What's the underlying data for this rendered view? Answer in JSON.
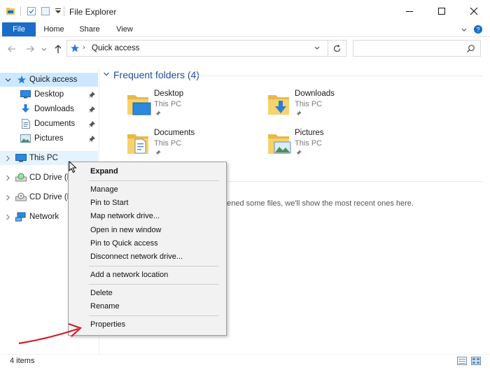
{
  "window": {
    "title": "File Explorer",
    "minimize_icon": "minimize-icon",
    "maximize_icon": "maximize-icon",
    "close_icon": "close-icon"
  },
  "ribbon": {
    "tabs": [
      {
        "label": "File"
      },
      {
        "label": "Home"
      },
      {
        "label": "Share"
      },
      {
        "label": "View"
      }
    ]
  },
  "address": {
    "path": "Quick access",
    "search_placeholder": ""
  },
  "nav": {
    "quick_access": "Quick access",
    "pinned": [
      {
        "label": "Desktop"
      },
      {
        "label": "Downloads"
      },
      {
        "label": "Documents"
      },
      {
        "label": "Pictures"
      }
    ],
    "this_pc": "This PC",
    "cd_drive_1": "CD Drive (D:",
    "cd_drive_2": "CD Drive (E:)",
    "network": "Network"
  },
  "content": {
    "frequent_header": "Frequent folders (4)",
    "folders": [
      {
        "name": "Desktop",
        "location": "This PC"
      },
      {
        "name": "Downloads",
        "location": "This PC"
      },
      {
        "name": "Documents",
        "location": "This PC"
      },
      {
        "name": "Pictures",
        "location": "This PC"
      }
    ],
    "recent_message": "pened some files, we'll show the most recent ones here."
  },
  "context_menu": {
    "expand": "Expand",
    "manage": "Manage",
    "pin_to_start": "Pin to Start",
    "map_network_drive": "Map network drive...",
    "open_new_window": "Open in new window",
    "pin_quick_access": "Pin to Quick access",
    "disconnect_network_drive": "Disconnect network drive...",
    "add_network_location": "Add a network location",
    "delete": "Delete",
    "rename": "Rename",
    "properties": "Properties"
  },
  "status": {
    "items": "4 items"
  },
  "colors": {
    "accent": "#1a6dc9",
    "selection": "#cce8ff",
    "header_blue": "#1e4e9c",
    "annotation_arrow": "#d01c28",
    "folder_yellow": "#f7d36b"
  }
}
